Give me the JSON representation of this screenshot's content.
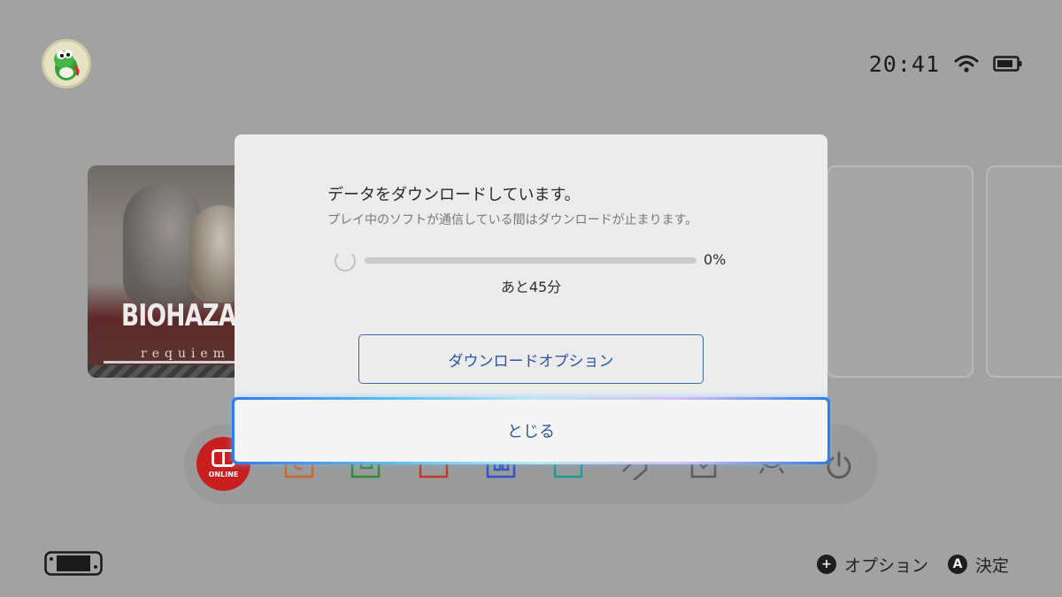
{
  "status_bar": {
    "time": "20:41"
  },
  "game_tile": {
    "logo_text": "BIOHAZAR",
    "sub_text": "requiem"
  },
  "dock": {
    "online_label": "ONLINE",
    "icons": [
      "news-icon",
      "eshop-icon",
      "album-icon",
      "controllers-icon",
      "game-card-icon",
      "virtual-game-card-icon",
      "screenshot-icon",
      "settings-icon",
      "power-icon"
    ]
  },
  "dialog": {
    "title": "データをダウンロードしています。",
    "subtitle": "プレイ中のソフトが通信している間はダウンロードが止まります。",
    "progress_label": "0%",
    "progress_value": 0,
    "remaining": "あと45分",
    "options_button": "ダウンロードオプション",
    "close_button": "とじる"
  },
  "hints": {
    "options_symbol": "+",
    "options_label": "オプション",
    "confirm_symbol": "A",
    "confirm_label": "決定"
  },
  "colors": {
    "accent_blue": "#2a56a6",
    "online_red": "#c81e1e"
  }
}
